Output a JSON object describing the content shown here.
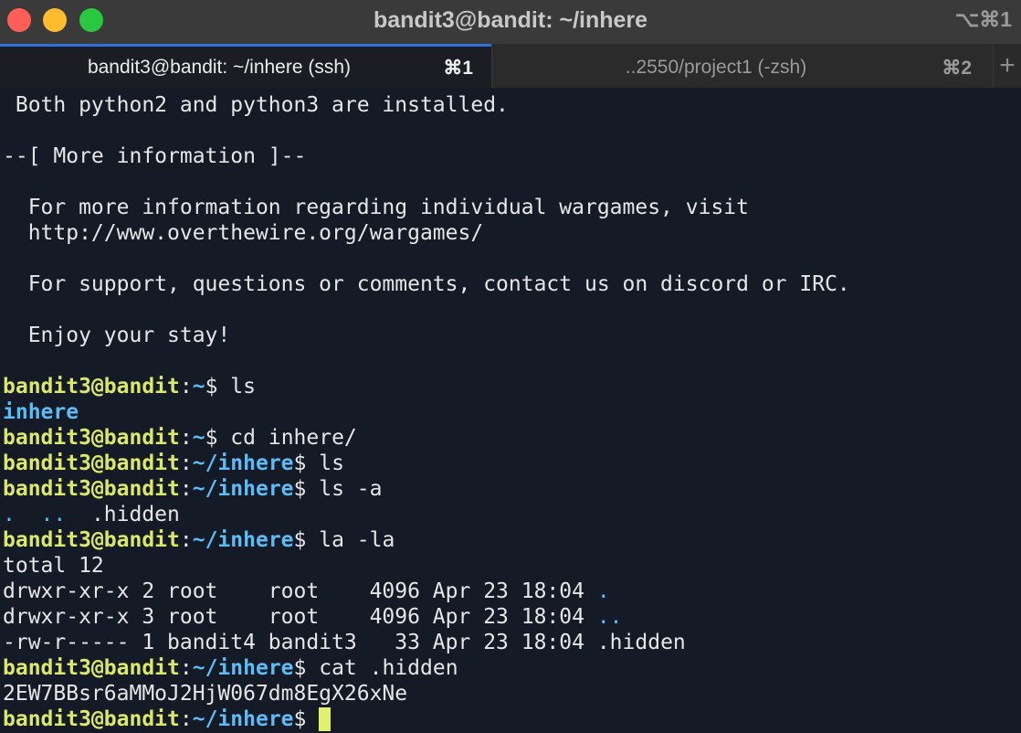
{
  "window": {
    "title": "bandit3@bandit: ~/inhere",
    "shortcut": "⌥⌘1"
  },
  "tabs": [
    {
      "label": "bandit3@bandit: ~/inhere (ssh)",
      "key": "⌘1",
      "active": true
    },
    {
      "label": "..2550/project1 (-zsh)",
      "key": "⌘2",
      "active": false
    }
  ],
  "new_tab_symbol": "+",
  "prompt": {
    "user_host": "bandit3@bandit",
    "colon": ":",
    "home": "~",
    "inhere_dir": "~/inhere",
    "dollar": "$"
  },
  "terminal": {
    "motd_python": " Both python2 and python3 are installed.",
    "motd_more_header": "--[ More information ]--",
    "motd_visit": "  For more information regarding individual wargames, visit",
    "motd_url": "  http://www.overthewire.org/wargames/",
    "motd_support": "  For support, questions or comments, contact us on discord or IRC.",
    "motd_enjoy": "  Enjoy your stay!",
    "cmd_ls": " ls",
    "out_inhere": "inhere",
    "cmd_cd": " cd inhere/",
    "cmd_ls2": " ls",
    "cmd_ls_a": " ls -a",
    "out_dots": ".  ..",
    "out_hidden": "  .hidden",
    "cmd_la": " la -la",
    "out_total": "total 12",
    "rows": [
      {
        "meta": "drwxr-xr-x 2 root    root    4096 Apr 23 18:04 ",
        "name": "."
      },
      {
        "meta": "drwxr-xr-x 3 root    root    4096 Apr 23 18:04 ",
        "name": ".."
      },
      {
        "meta": "-rw-r----- 1 bandit4 bandit3   33 Apr 23 18:04 ",
        "name": ".hidden"
      }
    ],
    "cmd_cat": " cat .hidden",
    "out_password": "2EW7BBsr6aMMoJ2HjW067dm8EgX26xNe",
    "final_space": " "
  },
  "colors": {
    "background": "#151b26",
    "prompt_user": "#dbe86a",
    "directory": "#5dbbf5",
    "cursor": "#e3f06e",
    "active_tab_indicator": "#2f6fd8"
  }
}
